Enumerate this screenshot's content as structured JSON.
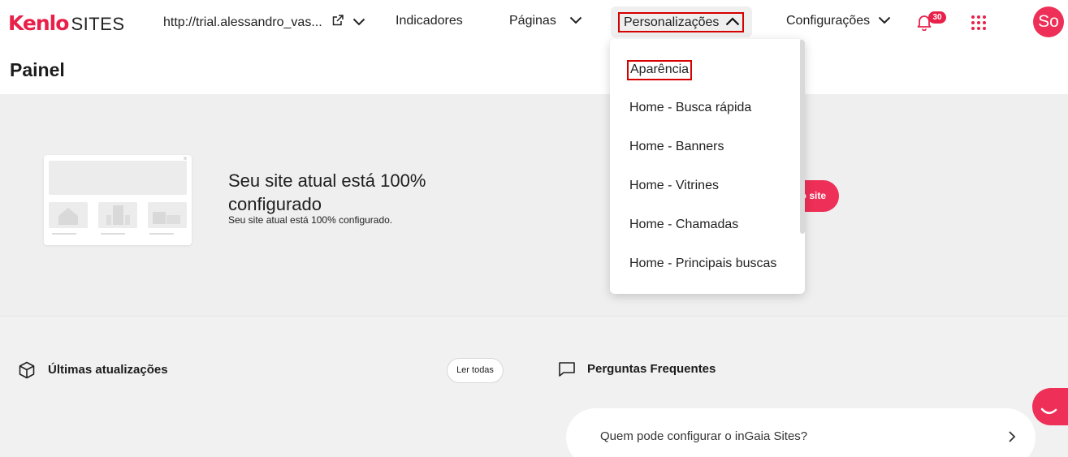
{
  "brand": {
    "logo_primary": "Kenlo",
    "logo_secondary": "SITES",
    "color": "#e8204a"
  },
  "nav": {
    "site_url": "http://trial.alessandro_vas...",
    "indicators": "Indicadores",
    "pages": "Páginas",
    "customizations": "Personalizações",
    "settings": "Configurações",
    "notifications_count": "30",
    "avatar_initials": "So"
  },
  "page_title": "Painel",
  "hero": {
    "title": "Seu site atual está 100% configurado",
    "subtitle": "Seu site atual está 100% configurado.",
    "button_label": "o site"
  },
  "dropdown": {
    "items": [
      "Aparência",
      "Home - Busca rápida",
      "Home - Banners",
      "Home - Vitrines",
      "Home - Chamadas",
      "Home - Principais buscas"
    ],
    "selected_index": 0
  },
  "updates": {
    "title": "Últimas atualizações",
    "read_all": "Ler todas"
  },
  "faq": {
    "title": "Perguntas Frequentes",
    "items": [
      "Quem pode configurar o inGaia Sites?"
    ]
  }
}
